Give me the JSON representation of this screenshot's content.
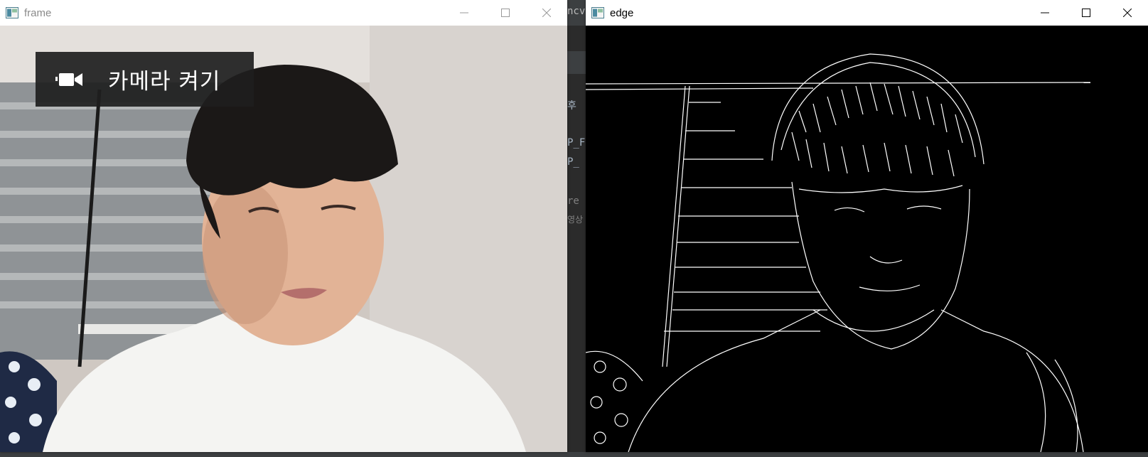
{
  "background_ide": {
    "tab_fragment": "ncv",
    "line_fragments": [
      "후",
      "P_F",
      "P_",
      "re",
      "영상"
    ]
  },
  "windows": [
    {
      "id": "frame",
      "title": "frame",
      "overlay_button": {
        "icon": "video-camera-icon",
        "label": "카메라 켜기"
      }
    },
    {
      "id": "edge",
      "title": "edge"
    }
  ],
  "colors": {
    "titlebar": "#ffffff",
    "overlay_bg": "#1e1e1e",
    "edge_bg": "#000000",
    "edge_lines": "#ffffff"
  }
}
